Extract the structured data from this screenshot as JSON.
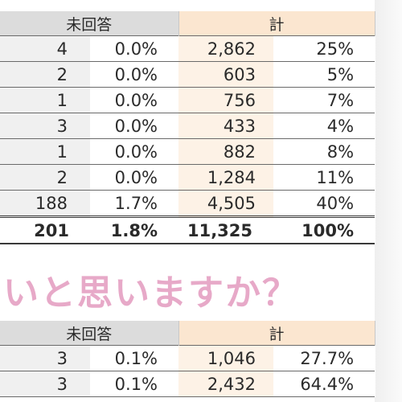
{
  "table1": {
    "headers": {
      "unanswered": "未回答",
      "total": "計"
    },
    "rows": [
      {
        "count": "4",
        "pct": "0.0%",
        "total": "2,862",
        "total_pct": "25%"
      },
      {
        "count": "2",
        "pct": "0.0%",
        "total": "603",
        "total_pct": "5%"
      },
      {
        "count": "1",
        "pct": "0.0%",
        "total": "756",
        "total_pct": "7%"
      },
      {
        "count": "3",
        "pct": "0.0%",
        "total": "433",
        "total_pct": "4%"
      },
      {
        "count": "1",
        "pct": "0.0%",
        "total": "882",
        "total_pct": "8%"
      },
      {
        "count": "2",
        "pct": "0.0%",
        "total": "1,284",
        "total_pct": "11%"
      },
      {
        "count": "188",
        "pct": "1.7%",
        "total": "4,505",
        "total_pct": "40%"
      }
    ],
    "total_row": {
      "count": "201",
      "pct": "1.8%",
      "total": "11,325",
      "total_pct": "100%"
    }
  },
  "question_text": "いと思いますか？",
  "table2": {
    "headers": {
      "unanswered": "未回答",
      "total": "計"
    },
    "rows": [
      {
        "count": "3",
        "pct": "0.1%",
        "total": "1,046",
        "total_pct": "27.7%"
      },
      {
        "count": "3",
        "pct": "0.1%",
        "total": "2,432",
        "total_pct": "64.4%"
      }
    ]
  },
  "colors": {
    "header_gray": "#dcdcdc",
    "header_peach": "#fbe6d0",
    "question_pink": "#e7a9c8"
  }
}
